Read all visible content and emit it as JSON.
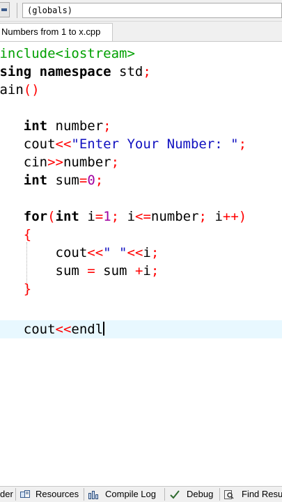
{
  "toolbar": {
    "scope_value": "(globals)"
  },
  "editor_tab": {
    "label": "Numbers from 1 to x.cpp"
  },
  "code_lines": [
    "#include<iostream>",
    "using namespace std;",
    "main()",
    "",
    "    int number;",
    "    cout<<\"Enter Your Number: \";",
    "    cin>>number;",
    "    int sum=0;",
    "",
    "    for(int i=1; i<=number; i++)",
    "    {",
    "        cout<<\" \"<<i;",
    "        sum = sum +i;",
    "    }",
    "",
    "    cout<<endl"
  ],
  "bottom_tabs": [
    {
      "label": "der",
      "icon": "compiler-icon"
    },
    {
      "label": "Resources",
      "icon": "resources-icon"
    },
    {
      "label": "Compile Log",
      "icon": "compile-log-icon"
    },
    {
      "label": "Debug",
      "icon": "debug-icon"
    },
    {
      "label": "Find Resu",
      "icon": "find-results-icon"
    }
  ],
  "colors": {
    "keyword": "#000000",
    "preprocessor": "#00a000",
    "operator": "#ff0000",
    "number": "#a000a0",
    "string": "#1010c0",
    "active_line": "#e8f8ff"
  }
}
